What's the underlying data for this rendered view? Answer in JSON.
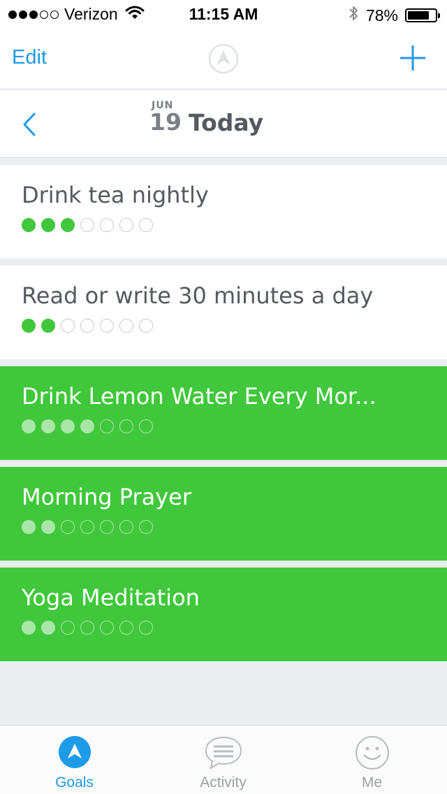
{
  "status_bar": {
    "carrier": "Verizon",
    "time": "11:15 AM",
    "battery_percent": "78%",
    "battery_level": 0.78,
    "signal_bars_filled": 3,
    "signal_bars_total": 5
  },
  "nav": {
    "edit_label": "Edit",
    "logo_icon": "app-logo-icon",
    "add_icon": "plus-icon"
  },
  "date": {
    "month": "JUN",
    "day": "19",
    "label": "Today",
    "back_icon": "chevron-left-icon"
  },
  "colors": {
    "accent": "#1e9be8",
    "done_green": "#41c73c",
    "text": "#545a60"
  },
  "goals": [
    {
      "title": "Drink tea nightly",
      "filled": 3,
      "total": 7,
      "completed_today": false
    },
    {
      "title": "Read or write 30 minutes a day",
      "filled": 2,
      "total": 7,
      "completed_today": false
    },
    {
      "title": "Drink Lemon Water Every Mor...",
      "filled": 4,
      "total": 7,
      "completed_today": true
    },
    {
      "title": "Morning Prayer",
      "filled": 2,
      "total": 7,
      "completed_today": true
    },
    {
      "title": "Yoga Meditation",
      "filled": 2,
      "total": 7,
      "completed_today": true
    }
  ],
  "tabs": [
    {
      "label": "Goals",
      "icon": "goals-icon",
      "active": true
    },
    {
      "label": "Activity",
      "icon": "chat-bubble-icon",
      "active": false
    },
    {
      "label": "Me",
      "icon": "smiley-icon",
      "active": false
    }
  ]
}
